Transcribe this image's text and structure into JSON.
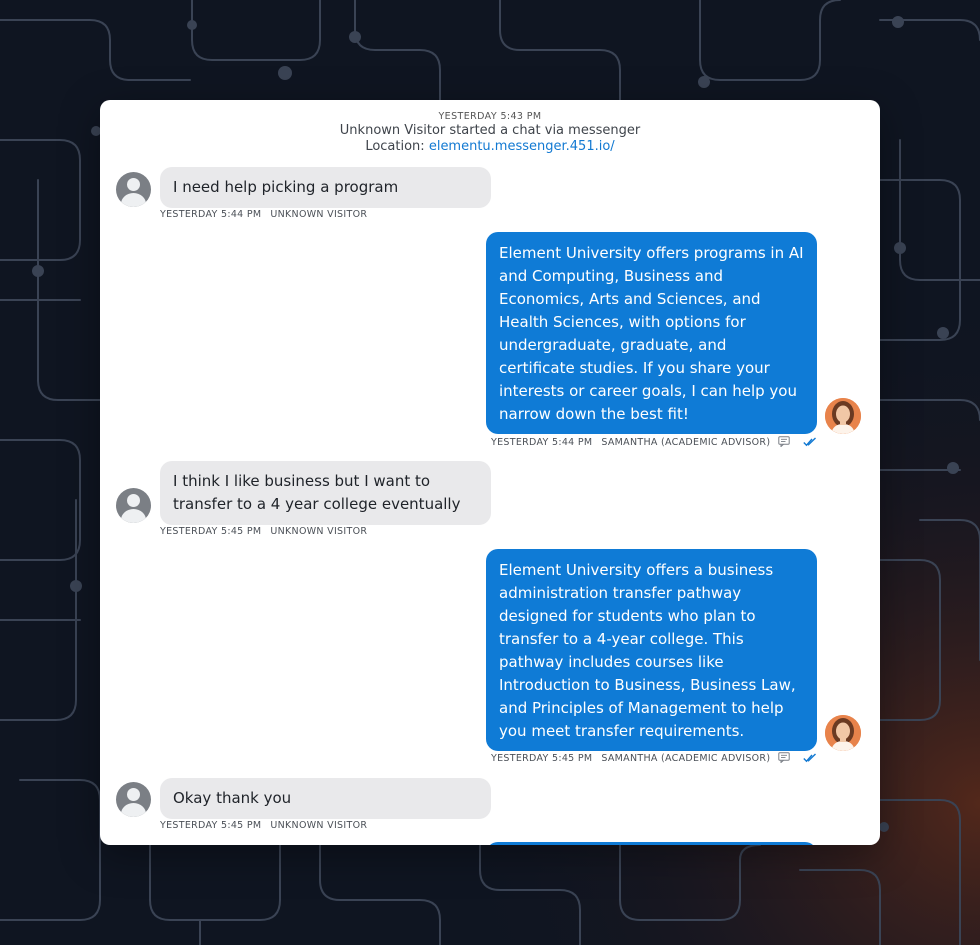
{
  "header": {
    "timestamp": "YESTERDAY 5:43 PM",
    "started_line": "Unknown Visitor started a chat via messenger",
    "location_label": "Location:",
    "location_url": "elementu.messenger.451.io/"
  },
  "messages": [
    {
      "sender": "visitor",
      "text": "I need help picking a program",
      "time": "YESTERDAY 5:44 PM",
      "name": "UNKNOWN VISITOR"
    },
    {
      "sender": "agent",
      "text": "Element University offers programs in AI and Computing, Business and Economics, Arts and Sciences, and Health Sciences, with options for undergraduate, graduate, and certificate studies. If you share your interests or career goals, I can help you narrow down the best fit!",
      "time": "YESTERDAY 5:44 PM",
      "name": "SAMANTHA (ACADEMIC ADVISOR)"
    },
    {
      "sender": "visitor",
      "text": "I think I like business but I want to transfer to a 4 year college eventually",
      "time": "YESTERDAY 5:45 PM",
      "name": "UNKNOWN VISITOR"
    },
    {
      "sender": "agent",
      "text": "Element University offers a business administration transfer pathway designed for students who plan to transfer to a 4-year college. This pathway includes courses like Introduction to Business, Business Law, and Principles of Management to help you meet transfer requirements.",
      "time": "YESTERDAY 5:45 PM",
      "name": "SAMANTHA (ACADEMIC ADVISOR)"
    },
    {
      "sender": "visitor",
      "text": "Okay thank you",
      "time": "YESTERDAY 5:45 PM",
      "name": "UNKNOWN VISITOR"
    }
  ],
  "icons": {
    "visitor_avatar": "person-icon",
    "agent_avatar": "agent-photo",
    "note": "note-icon",
    "read_receipt": "double-check-icon"
  },
  "colors": {
    "agent_bubble": "#0f7bd6",
    "visitor_bubble": "#e9e9eb",
    "link": "#1279d2",
    "background": "#0f1521",
    "read_check": "#1279d2"
  }
}
